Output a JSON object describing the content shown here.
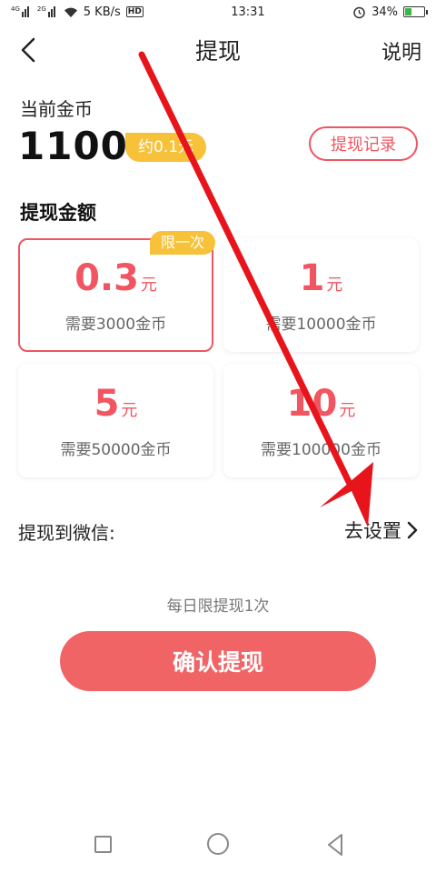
{
  "status_bar": {
    "signal1_label": "4G",
    "signal2_label": "2G",
    "speed": "5 KB/s",
    "hd": "HD",
    "time": "13:31",
    "battery": "34%",
    "battery_level": 0.34
  },
  "nav": {
    "title": "提现",
    "help": "说明"
  },
  "coins": {
    "label": "当前金币",
    "value": "1100",
    "approx": "约0.1元",
    "record_button": "提现记录"
  },
  "section_title": "提现金额",
  "options": [
    {
      "amount": "0.3",
      "unit": "元",
      "need": "需要3000金币",
      "badge": "限一次",
      "selected": true
    },
    {
      "amount": "1",
      "unit": "元",
      "need": "需要10000金币",
      "selected": false
    },
    {
      "amount": "5",
      "unit": "元",
      "need": "需要50000金币",
      "selected": false
    },
    {
      "amount": "10",
      "unit": "元",
      "need": "需要100000金币",
      "selected": false
    }
  ],
  "wechat": {
    "label": "提现到微信:",
    "setting": "去设置"
  },
  "daily_note": "每日限提现1次",
  "confirm_button": "确认提现",
  "colors": {
    "accent_red": "#f05561",
    "badge_yellow": "#f7c23a",
    "button_red": "#f16466",
    "annotation_arrow": "#e8141c"
  }
}
